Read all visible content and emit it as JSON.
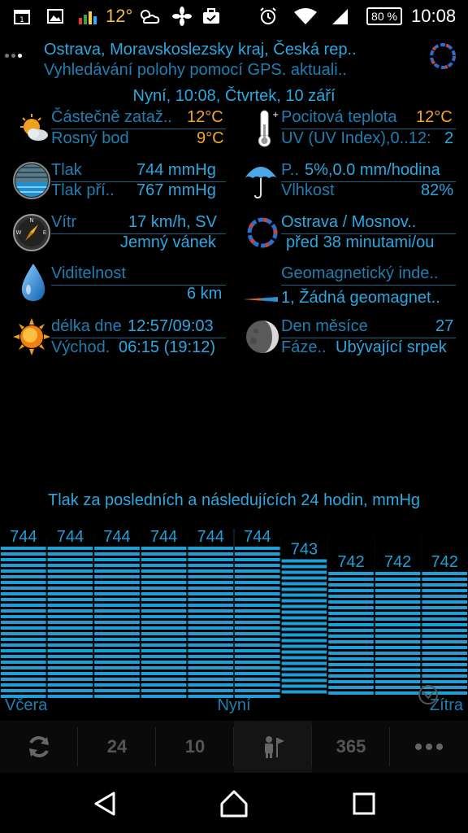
{
  "status_bar": {
    "temperature": "12°",
    "battery": "80 %",
    "time": "10:08",
    "icons": [
      "calendar-icon",
      "image-icon",
      "stocks-icon",
      "weather-cloud-icon",
      "fan-icon",
      "briefcase-icon",
      "alarm-icon",
      "wifi-icon",
      "signal-icon",
      "battery-icon"
    ]
  },
  "header": {
    "location": "Ostrava, Moravskoslezsky kraj, Česká rep..",
    "subtitle": "Vyhledávání polohy pomocí GPS. aktuali..",
    "now": "Nyní, 10:08, Čtvrtek, 10 září"
  },
  "weather": {
    "condition_label": "Částečně zataž..",
    "condition_value": "12°C",
    "dew_label": "Rosný bod",
    "dew_value": "9°C",
    "feels_label": "Pocitová teplota",
    "feels_value": "12°C",
    "uv_label": "UV (UV Index),0..12:",
    "uv_value": "2",
    "pressure_label": "Tlak",
    "pressure_value": "744 mmHg",
    "pressure2_label": "Tlak pří..",
    "pressure2_value": "767 mmHg",
    "precip_label": "P..",
    "precip_value": "5%,0.0 mm/hodina",
    "humidity_label": "Vlhkost",
    "humidity_value": "82%",
    "wind_label": "Vítr",
    "wind_value": "17 km/h, SV",
    "wind_desc": "Jemný vánek",
    "station_name": "Ostrava / Mosnov..",
    "station_time": "před 38 minutami/ou",
    "visibility_label": "Viditelnost",
    "visibility_value": "6 km",
    "geomag_label": "Geomagnetický inde..",
    "geomag_value": "1, Žádná geomagnet..",
    "daylength_label": "délka dne",
    "daylength_value": "12:57/09:03",
    "sunrise_label": "Východ.",
    "sunrise_value": "06:15 (19:12)",
    "moonday_label": "Den měsíce",
    "moonday_value": "27",
    "phase_label": "Fáze..",
    "phase_value": "Ubývající srpek"
  },
  "chart_data": {
    "type": "bar",
    "title": "Tlak za posledních a následujících 24 hodin, mmHg",
    "values": [
      744,
      744,
      744,
      744,
      744,
      744,
      743,
      742,
      742,
      742
    ],
    "x_labels": {
      "left": "Včera",
      "center": "Nyní",
      "right": "Zítra"
    },
    "color": "#1f9fd8"
  },
  "toolbar": {
    "refresh_icon": "refresh-icon",
    "tab_24": "24",
    "tab_10": "10",
    "person_icon": "person-flag-icon",
    "tab_365": "365",
    "more_icon": "more-icon"
  },
  "navbar": {
    "back_icon": "back-icon",
    "home_icon": "home-icon",
    "recents_icon": "recents-icon"
  }
}
